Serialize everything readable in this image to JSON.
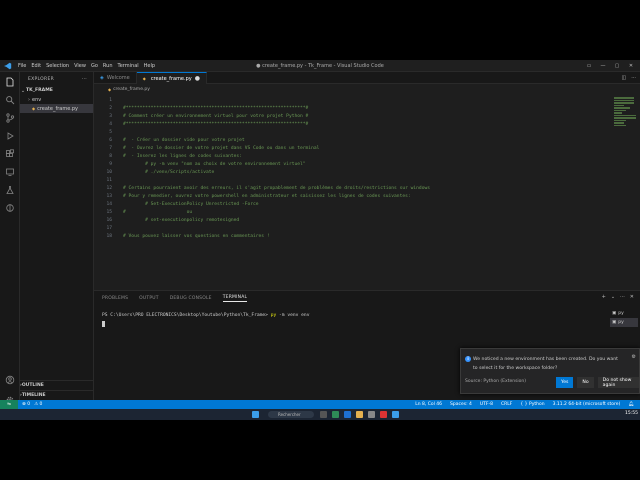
{
  "window": {
    "title": "● create_frame.py - Tk_Frame - Visual Studio Code",
    "menu": [
      "File",
      "Edit",
      "Selection",
      "View",
      "Go",
      "Run",
      "Terminal",
      "Help"
    ]
  },
  "sidebar": {
    "header": "EXPLORER",
    "folder": "TK_FRAME",
    "items": [
      {
        "label": "env",
        "kind": "folder"
      },
      {
        "label": "create_frame.py",
        "kind": "python",
        "selected": true
      }
    ],
    "outline_label": "OUTLINE",
    "timeline_label": "TIMELINE"
  },
  "tabs": [
    {
      "label": "Welcome",
      "active": false
    },
    {
      "label": "create_frame.py",
      "active": true,
      "modified": true
    }
  ],
  "breadcrumb": "create_frame.py",
  "editor": {
    "lines": [
      {
        "n": "1",
        "text": ""
      },
      {
        "n": "2",
        "text": "#*****************************************************************#"
      },
      {
        "n": "3",
        "text": "# Comment créer un environnement virtuel pour votre projet Python #"
      },
      {
        "n": "4",
        "text": "#*****************************************************************#"
      },
      {
        "n": "5",
        "text": ""
      },
      {
        "n": "6",
        "text": "#  - Créer un dossier vide pour votre projet"
      },
      {
        "n": "7",
        "text": "#  - Ouvrez le dossier de votre projet dans VS Code ou dans un terminal"
      },
      {
        "n": "8",
        "text": "#  - Inserez les lignes de codes suivantes:"
      },
      {
        "n": "9",
        "text": "        # py -m venv \"nom au choix de votre environnement virtuel\""
      },
      {
        "n": "10",
        "text": "        # ./venv/Scripts/activate"
      },
      {
        "n": "11",
        "text": ""
      },
      {
        "n": "12",
        "text": "# Certains pourraient avoir des erreurs, il s'agit propablement de problèmes de droits/restrictions sur windows"
      },
      {
        "n": "13",
        "text": "# Pour y remedier, ouvrez votre powershell en administrateur et saisissez les lignes de codes suivantes:"
      },
      {
        "n": "14",
        "text": "        # Set-ExecutionPolicy Unrestricted -Force"
      },
      {
        "n": "15",
        "text": "#                      ou"
      },
      {
        "n": "16",
        "text": "        # set-executionpolicy remotesigned"
      },
      {
        "n": "17",
        "text": ""
      },
      {
        "n": "18",
        "text": "# Vous pouvez laisser vos questions en commentaires !"
      }
    ]
  },
  "panel": {
    "tabs": [
      {
        "label": "PROBLEMS",
        "active": false
      },
      {
        "label": "OUTPUT",
        "active": false
      },
      {
        "label": "DEBUG CONSOLE",
        "active": false
      },
      {
        "label": "TERMINAL",
        "active": true
      }
    ],
    "prompt": "PS C:\\Users\\PRO ELECTRONICS\\Desktop\\Youtube\\Python\\Tk_Frame> ",
    "command": "py",
    "args": " -m venv env",
    "terminals": [
      "py",
      "py"
    ]
  },
  "notification": {
    "message": "We noticed a new environment has been created. Do you want to select it for the workspace folder?",
    "source": "Source: Python (Extension)",
    "buttons": [
      "Yes",
      "No",
      "Do not show again"
    ]
  },
  "statusbar": {
    "errors": "⊗ 0",
    "warnings": "⚠ 0",
    "position": "Ln 8, Col 46",
    "spaces": "Spaces: 4",
    "encoding": "UTF-8",
    "eol": "CRLF",
    "language": "{ } Python",
    "interpreter": "3.11.2 64-bit (microsoft store)"
  },
  "taskbar": {
    "search_label": "Rechercher",
    "time": "15:55"
  },
  "colors": {
    "accent": "#0078d4",
    "comment": "#6a9955",
    "statusbar": "#0078d4"
  }
}
